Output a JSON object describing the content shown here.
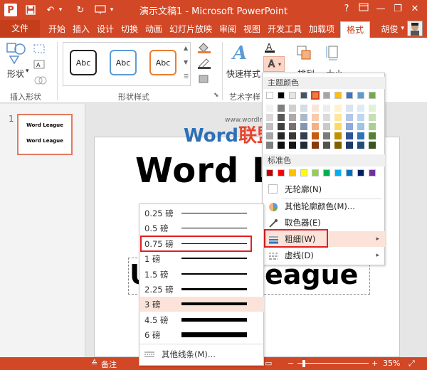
{
  "window": {
    "title": "演示文稿1 - Microsoft PowerPoint",
    "help": "?",
    "minimize": "—",
    "restore": "❐",
    "close": "✕"
  },
  "quick_access": {
    "app_icon": "P",
    "save": "💾",
    "undo": "↶",
    "redo": "↻",
    "dropdown": "▾"
  },
  "tabs": [
    {
      "label": "文件"
    },
    {
      "label": "开始"
    },
    {
      "label": "插入"
    },
    {
      "label": "设计"
    },
    {
      "label": "切换"
    },
    {
      "label": "动画"
    },
    {
      "label": "幻灯片放映"
    },
    {
      "label": "审阅"
    },
    {
      "label": "视图"
    },
    {
      "label": "开发工具"
    },
    {
      "label": "加载项"
    },
    {
      "label": "格式"
    }
  ],
  "user": {
    "name": "胡俊",
    "dropdown": "▾"
  },
  "ribbon": {
    "shape_btn": "形状",
    "group_insert_shapes": "插入形状",
    "group_shape_styles": "形状样式",
    "group_art_text": "艺术字样",
    "quick_styles": "快速样式",
    "arrange": "排列",
    "size": "大小",
    "style_sample": "Abc"
  },
  "slides": {
    "number": "1",
    "thumb_line1": "Word League",
    "thumb_line2": "Word League"
  },
  "slide": {
    "title_text": "Word Le",
    "sub_text_left": "U",
    "sub_text_right": "eague"
  },
  "watermark": {
    "word": "Word",
    "cn": "联盟",
    "url": "www.wordlm.com"
  },
  "color_panel": {
    "theme_header": "主题颜色",
    "standard_header": "标准色",
    "no_outline": "无轮廓(N)",
    "more_colors": "其他轮廓颜色(M)...",
    "eyedropper": "取色器(E)",
    "weight": "粗细(W)",
    "dashes": "虚线(D)",
    "arrow": "▸",
    "theme_top": [
      "#ffffff",
      "#000000",
      "#e7e6e6",
      "#44546a",
      "#ed7d31",
      "#a5a5a5",
      "#ffc000",
      "#4472c4",
      "#5b9bd5",
      "#70ad47"
    ],
    "theme_columns": [
      [
        "#f2f2f2",
        "#d9d9d9",
        "#bfbfbf",
        "#a6a6a6",
        "#7f7f7f"
      ],
      [
        "#7f7f7f",
        "#595959",
        "#404040",
        "#262626",
        "#0d0d0d"
      ],
      [
        "#d0cece",
        "#aeaaaa",
        "#757171",
        "#3a3838",
        "#171616"
      ],
      [
        "#d6dce4",
        "#adb9ca",
        "#8497b0",
        "#333f4f",
        "#222a35"
      ],
      [
        "#fbe5d6",
        "#f8cbad",
        "#f4b183",
        "#c55a11",
        "#843c0c"
      ],
      [
        "#ededed",
        "#dbdbdb",
        "#c9c9c9",
        "#7b7b7b",
        "#525252"
      ],
      [
        "#fff2cc",
        "#ffe699",
        "#ffd966",
        "#bf9000",
        "#7f6000"
      ],
      [
        "#dae3f3",
        "#b4c7e7",
        "#8faadc",
        "#2f5597",
        "#1f3864"
      ],
      [
        "#deebf7",
        "#bdd7ee",
        "#9dc3e6",
        "#2e75b6",
        "#1f4e79"
      ],
      [
        "#e2f0d9",
        "#c5e0b4",
        "#a9d18e",
        "#548235",
        "#385723"
      ]
    ],
    "standard": [
      "#c00000",
      "#ff0000",
      "#ffc000",
      "#ffff00",
      "#92d050",
      "#00b050",
      "#00b0f0",
      "#0070c0",
      "#002060",
      "#7030a0"
    ]
  },
  "weight_menu": {
    "items": [
      {
        "label": "0.25 磅",
        "thickness": 1
      },
      {
        "label": "0.5 磅",
        "thickness": 1
      },
      {
        "label": "0.75 磅",
        "thickness": 1
      },
      {
        "label": "1 磅",
        "thickness": 2
      },
      {
        "label": "1.5 磅",
        "thickness": 2
      },
      {
        "label": "2.25 磅",
        "thickness": 3
      },
      {
        "label": "3 磅",
        "thickness": 4
      },
      {
        "label": "4.5 磅",
        "thickness": 5
      },
      {
        "label": "6 磅",
        "thickness": 7
      }
    ],
    "more": "其他线条(M)..."
  },
  "status": {
    "notes": "备注",
    "zoom": "35%",
    "minus": "−",
    "plus": "+"
  },
  "colors": {
    "accent": "#d24726",
    "highlight": "#fbe3d9",
    "callout": "#e02020"
  }
}
